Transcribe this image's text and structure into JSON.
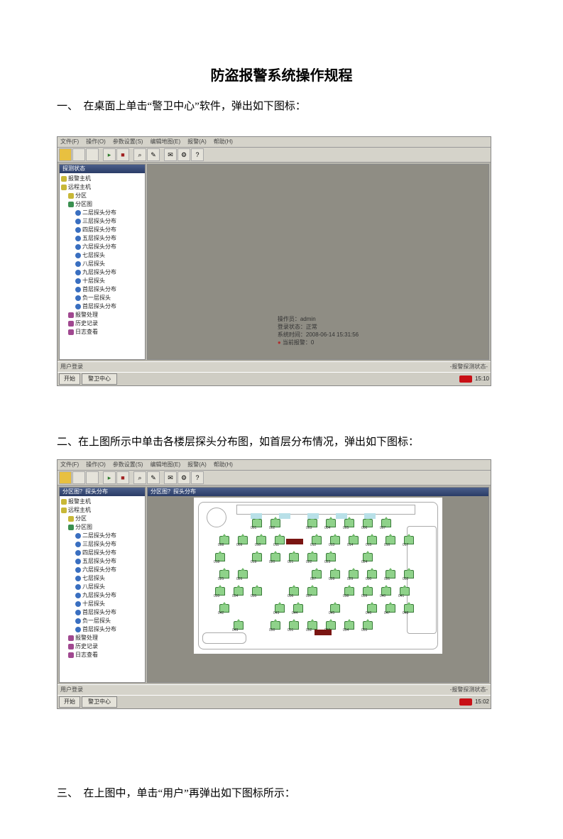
{
  "doc": {
    "title": "防盗报警系统操作规程",
    "section1": "一、　在桌面上单击“警卫中心”软件，弹出如下图标：",
    "section2": "二、在上图所示中单击各楼层探头分布图，如首层分布情况，弹出如下图标：",
    "section3": "三、　在上图中，单击“用户”再弹出如下图标所示："
  },
  "app": {
    "menubar": [
      "文件(F)",
      "操作(O)",
      "参数设置(S)",
      "编辑地图(E)",
      "报警(A)",
      "帮助(H)"
    ],
    "tree_title1": "探测状态",
    "tree_title2": "分区图？探头分布",
    "tree": [
      {
        "lvl": 0,
        "icn": "y",
        "txt": "报警主机"
      },
      {
        "lvl": 0,
        "icn": "y",
        "txt": "远程主机"
      },
      {
        "lvl": 1,
        "icn": "y",
        "txt": "分区"
      },
      {
        "lvl": 1,
        "icn": "g",
        "txt": "分区图"
      },
      {
        "lvl": 2,
        "icn": "b",
        "txt": "二层探头分布"
      },
      {
        "lvl": 2,
        "icn": "b",
        "txt": "三层探头分布"
      },
      {
        "lvl": 2,
        "icn": "b",
        "txt": "四层探头分布"
      },
      {
        "lvl": 2,
        "icn": "b",
        "txt": "五层探头分布"
      },
      {
        "lvl": 2,
        "icn": "b",
        "txt": "六层探头分布"
      },
      {
        "lvl": 2,
        "icn": "b",
        "txt": "七层探头"
      },
      {
        "lvl": 2,
        "icn": "b",
        "txt": "八层探头"
      },
      {
        "lvl": 2,
        "icn": "b",
        "txt": "九层探头分布"
      },
      {
        "lvl": 2,
        "icn": "b",
        "txt": "十层探头"
      },
      {
        "lvl": 2,
        "icn": "b",
        "txt": "首层探头分布"
      },
      {
        "lvl": 2,
        "icn": "b",
        "txt": "负一层探头"
      },
      {
        "lvl": 2,
        "icn": "b",
        "txt": "首层探头分布"
      },
      {
        "lvl": 1,
        "icn": "p",
        "txt": "报警处理"
      },
      {
        "lvl": 1,
        "icn": "p",
        "txt": "历史记录"
      },
      {
        "lvl": 1,
        "icn": "p",
        "txt": "日志查看"
      }
    ],
    "info": {
      "l1": "操作员：admin",
      "l2": "登录状态：正常",
      "l3": "系统时间：2008-06-14 15:31:56",
      "l4": "当前报警：0"
    },
    "status_left": "用户登录",
    "status_right": "-报警探测状态-",
    "start": "开始",
    "taskbtn": "警卫中心",
    "clock1": "15:10",
    "clock2": "15:02"
  }
}
